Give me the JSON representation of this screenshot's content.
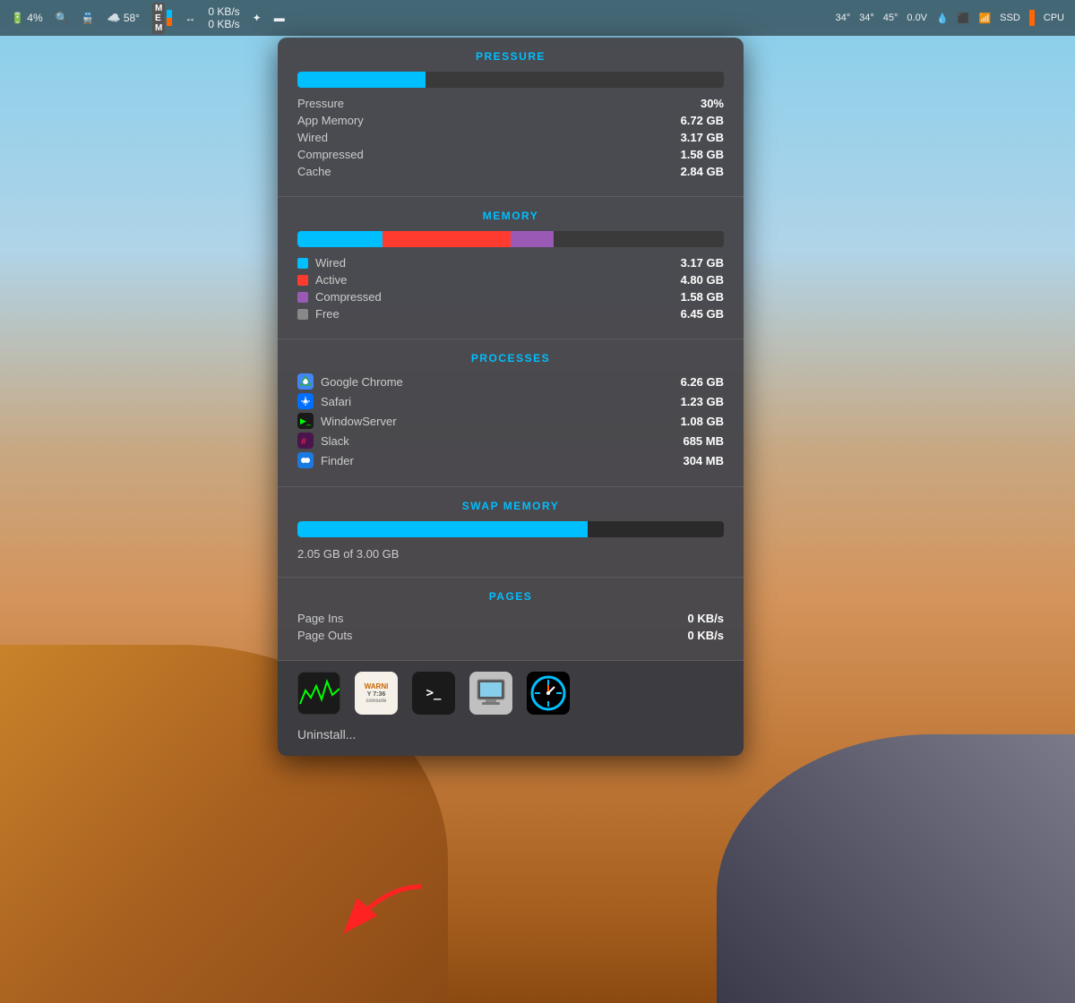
{
  "desktop": {
    "bg": "desert"
  },
  "menubar": {
    "battery": "4%",
    "mag_label": "🔍",
    "train_label": "🚆",
    "weather": "☁️ 58°",
    "mem_label": "MEM",
    "network_up": "0 KB/s",
    "network_down": "0 KB/s",
    "flux_icon": "✦",
    "screen_icon": "▬",
    "temp1": "34°",
    "temp2": "34°",
    "temp3": "45°",
    "voltage": "0.0V",
    "wifi_icon": "wifi",
    "ssd_label": "SSD",
    "cpu_label": "CPU"
  },
  "popup": {
    "sections": {
      "pressure": {
        "title": "PRESSURE",
        "bar_percent": 30,
        "rows": [
          {
            "label": "Pressure",
            "value": "30%"
          },
          {
            "label": "App Memory",
            "value": "6.72 GB"
          },
          {
            "label": "Wired",
            "value": "3.17 GB"
          },
          {
            "label": "Compressed",
            "value": "1.58 GB"
          },
          {
            "label": "Cache",
            "value": "2.84 GB"
          }
        ]
      },
      "memory": {
        "title": "MEMORY",
        "segments": [
          {
            "color": "cyan",
            "width_pct": 20
          },
          {
            "color": "red",
            "width_pct": 30
          },
          {
            "color": "purple",
            "width_pct": 10
          }
        ],
        "rows": [
          {
            "label": "Wired",
            "value": "3.17 GB",
            "dot": "cyan"
          },
          {
            "label": "Active",
            "value": "4.80 GB",
            "dot": "red"
          },
          {
            "label": "Compressed",
            "value": "1.58 GB",
            "dot": "purple"
          },
          {
            "label": "Free",
            "value": "6.45 GB",
            "dot": "gray"
          }
        ]
      },
      "processes": {
        "title": "PROCESSES",
        "rows": [
          {
            "label": "Google Chrome",
            "value": "6.26 GB",
            "icon": "chrome"
          },
          {
            "label": "Safari",
            "value": "1.23 GB",
            "icon": "safari"
          },
          {
            "label": "WindowServer",
            "value": "1.08 GB",
            "icon": "terminal"
          },
          {
            "label": "Slack",
            "value": "685 MB",
            "icon": "slack"
          },
          {
            "label": "Finder",
            "value": "304 MB",
            "icon": "finder"
          }
        ]
      },
      "swap_memory": {
        "title": "SWAP MEMORY",
        "bar_fill_pct": 68,
        "swap_text": "2.05 GB of 3.00 GB"
      },
      "pages": {
        "title": "PAGES",
        "rows": [
          {
            "label": "Page Ins",
            "value": "0 KB/s"
          },
          {
            "label": "Page Outs",
            "value": "0 KB/s"
          }
        ]
      }
    },
    "dock": {
      "icons": [
        {
          "name": "Activity Monitor",
          "type": "activity"
        },
        {
          "name": "Console",
          "type": "console",
          "line1": "WARNI",
          "line2": "Y 7:36"
        },
        {
          "name": "Terminal",
          "type": "terminal",
          "label": ">_"
        },
        {
          "name": "System Information",
          "type": "sysinfo"
        },
        {
          "name": "iStat Menus",
          "type": "ispeed"
        }
      ],
      "uninstall_label": "Uninstall..."
    }
  }
}
